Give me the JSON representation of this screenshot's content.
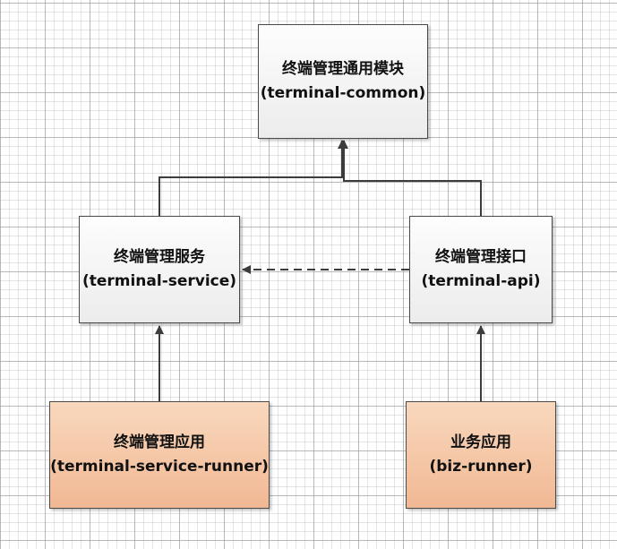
{
  "diagram": {
    "nodes": [
      {
        "id": "common",
        "title": "终端管理通用模块",
        "module": "(terminal-common)",
        "kind": "module"
      },
      {
        "id": "service",
        "title": "终端管理服务",
        "module": "(terminal-service)",
        "kind": "module"
      },
      {
        "id": "api",
        "title": "终端管理接口",
        "module": "(terminal-api)",
        "kind": "module"
      },
      {
        "id": "runner",
        "title": "终端管理应用",
        "module": "(terminal-service-runner)",
        "kind": "application"
      },
      {
        "id": "biz",
        "title": "业务应用",
        "module": "(biz-runner)",
        "kind": "application"
      }
    ],
    "edges": [
      {
        "from": "service",
        "to": "common",
        "style": "solid"
      },
      {
        "from": "api",
        "to": "common",
        "style": "solid"
      },
      {
        "from": "api",
        "to": "service",
        "style": "dashed"
      },
      {
        "from": "runner",
        "to": "service",
        "style": "solid"
      },
      {
        "from": "biz",
        "to": "api",
        "style": "solid"
      }
    ],
    "colors": {
      "module_fill": "#f5f5f5",
      "application_fill": "#f4c6a3",
      "line": "#3c3c3c",
      "grid_major": "#969696",
      "grid_minor": "#cdcdcd"
    }
  }
}
